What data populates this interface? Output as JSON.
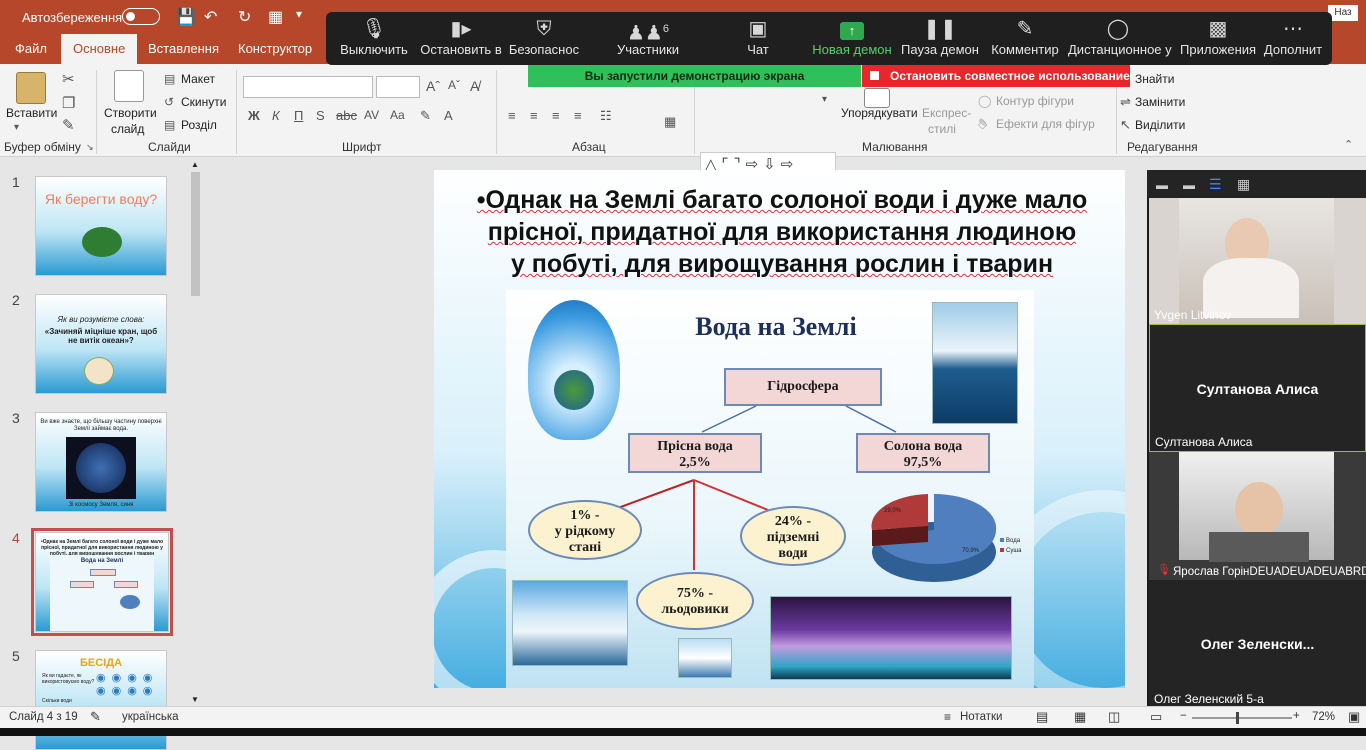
{
  "titlebar": {
    "autosave_label": "Автозбереження",
    "right_badge": "Наз"
  },
  "tabs": [
    {
      "label": "Файл"
    },
    {
      "label": "Основне"
    },
    {
      "label": "Вставлення"
    },
    {
      "label": "Конструктор"
    }
  ],
  "ribbon": {
    "paste": "Вставити",
    "clipboard_group": "Буфер обміну",
    "new_slide_1": "Створити",
    "new_slide_2": "слайд",
    "layout": "Макет",
    "reset": "Скинути",
    "section": "Розділ",
    "slides_group": "Слайди",
    "font_group": "Шрифт",
    "paragraph_group": "Абзац",
    "arrange": "Упорядкувати",
    "quick_styles_1": "Експрес-",
    "quick_styles_2": "стилі",
    "shape_outline": "Контур фігури",
    "shape_effects": "Ефекти для фігур",
    "drawing_group": "Малювання",
    "find": "Знайти",
    "replace": "Замінити",
    "select": "Виділити",
    "editing_group": "Редагування"
  },
  "zoom_toolbar": [
    {
      "label": "Выключить",
      "icon": "microphone-icon"
    },
    {
      "label": "Остановить в",
      "icon": "video-camera-icon"
    },
    {
      "label": "Безопаснос",
      "icon": "shield-icon"
    },
    {
      "label": "Участники",
      "icon": "participants-icon",
      "count": "6"
    },
    {
      "label": "Чат",
      "icon": "chat-icon"
    },
    {
      "label": "Новая демон",
      "icon": "share-screen-icon"
    },
    {
      "label": "Пауза демон",
      "icon": "pause-icon"
    },
    {
      "label": "Комментир",
      "icon": "annotate-icon"
    },
    {
      "label": "Дистанционное у",
      "icon": "remote-control-icon"
    },
    {
      "label": "Приложения",
      "icon": "apps-icon"
    },
    {
      "label": "Дополнит",
      "icon": "more-icon"
    }
  ],
  "banners": {
    "sharing": "Вы запустили демонстрацию экрана",
    "stop": "Остановить совместное использование"
  },
  "thumbnails": [
    {
      "num": "1",
      "title": "Як берегти воду?"
    },
    {
      "num": "2",
      "title": "Як ви розумієте слова:",
      "quote": "«Зачиняй міцніше кран, щоб не витік океан»?"
    },
    {
      "num": "3",
      "title": "Ви вже знаєте, що більшу частину поверхні Землі займає вода.",
      "caption": "Зі космосу Земля, синя"
    },
    {
      "num": "4",
      "title": "•Однак на Землі багато солоної води і дуже мало прісної, придатної для використання людиною у побуті, для вирощування рослин і тварин",
      "mini": "Вода на Землі"
    },
    {
      "num": "5",
      "title": "БЕСІДА",
      "l1": "Як ви гадаєте, як використовуємо воду?",
      "l2": "Скільки води"
    }
  ],
  "slide": {
    "title_line1": "•Однак на Землі багато солоної води і дуже мало",
    "title_line2": "прісної, придатної для використання людиною",
    "title_line3": "у побуті, для вирощування рослин і тварин",
    "inner_title": "Вода на Землі",
    "hydrosphere": "Гідросфера",
    "fresh_1": "Прісна вода",
    "fresh_2": "2,5%",
    "salt_1": "Солона вода",
    "salt_2": "97,5%",
    "liquid_1": "1% -",
    "liquid_2": "у рідкому",
    "liquid_3": "стані",
    "ground_1": "24% -",
    "ground_2": "підземні",
    "ground_3": "води",
    "glacier_1": "75% -",
    "glacier_2": "льодовики",
    "pie_label_small": "29,0%",
    "pie_label_big": "70,9%",
    "legend_1": "Вода",
    "legend_2": "Суша"
  },
  "participants": [
    {
      "name": "Yvgen Litvinov",
      "video": true
    },
    {
      "name": "Султанова Алиса",
      "center": "Султанова Алиса",
      "video": false,
      "active": true
    },
    {
      "name": "Ярослав ГорінDEUADEUADEUABRDE...",
      "video": true,
      "muted": true
    },
    {
      "name": "Олег Зеленский 5-а",
      "center": "Олег  Зеленски...",
      "video": false
    }
  ],
  "status": {
    "slide": "Слайд 4 з 19",
    "lang": "українська",
    "notes": "Нотатки",
    "zoom": "72%"
  },
  "colors": {
    "accent": "#b7472a",
    "zoom_bg": "#1f1f1f",
    "green": "#2fc05b",
    "red": "#e8262b"
  }
}
